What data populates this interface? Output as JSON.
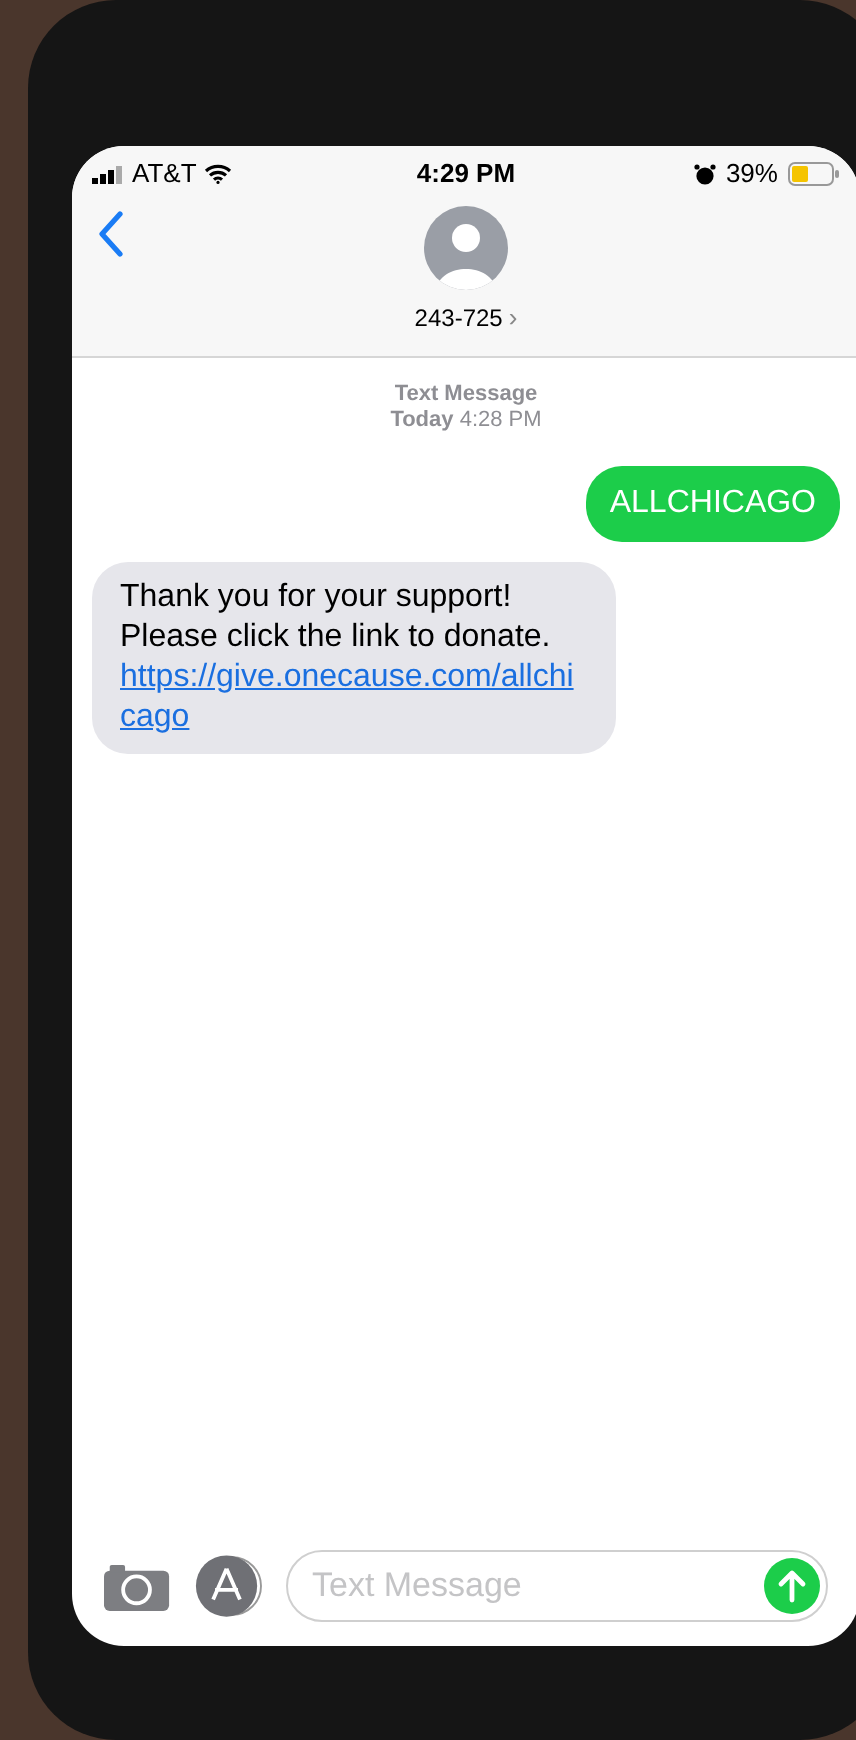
{
  "status_bar": {
    "carrier": "AT&T",
    "time": "4:29 PM",
    "battery": "39%"
  },
  "header": {
    "contact": "243-725",
    "chevron": "›"
  },
  "thread": {
    "label": "Text Message",
    "timestamp": "**Today** 4:28 PM"
  },
  "messages": [
    {
      "kind": "sent",
      "text": "ALLCHICAGO"
    },
    {
      "kind": "received",
      "text": "Thank you for your support! Please click the link to donate.",
      "link": "https://give.onecause.com/allchicago"
    }
  ],
  "composer": {
    "placeholder": "Text Message"
  }
}
